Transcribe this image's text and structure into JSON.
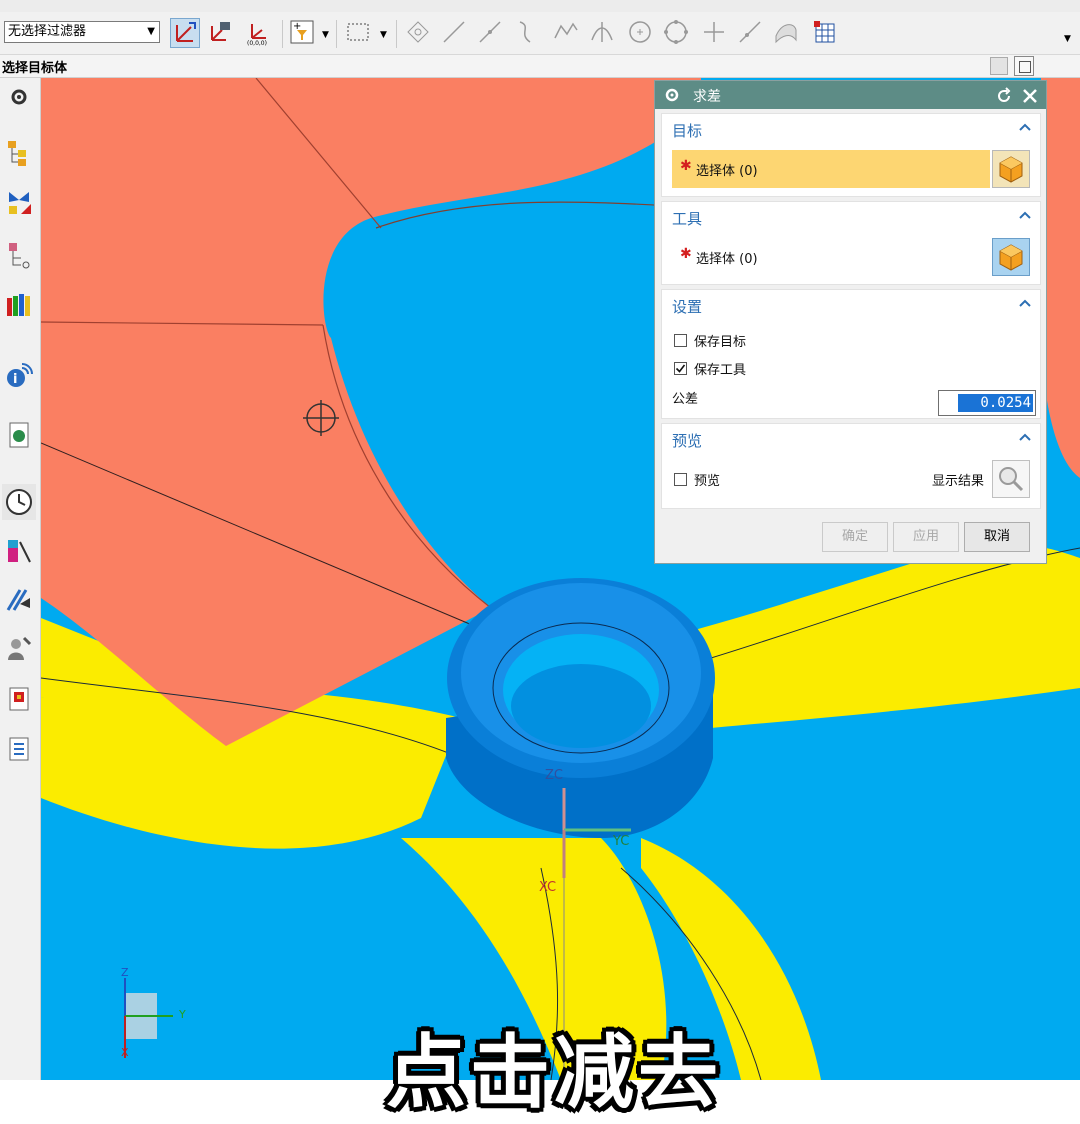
{
  "toolbar": {
    "selection_filter": "无选择过滤器"
  },
  "cue_line": "选择目标体",
  "dialog": {
    "title": "求差",
    "target": {
      "header": "目标",
      "select_label": "选择体 (0)"
    },
    "tool": {
      "header": "工具",
      "select_label": "选择体 (0)"
    },
    "settings": {
      "header": "设置",
      "keep_target": {
        "label": "保存目标",
        "checked": false
      },
      "keep_tool": {
        "label": "保存工具",
        "checked": true
      },
      "tolerance_label": "公差",
      "tolerance_value": "0.0254"
    },
    "preview": {
      "header": "预览",
      "preview_label": "预览",
      "preview_checked": false,
      "show_result_label": "显示结果"
    },
    "buttons": {
      "ok": "确定",
      "apply": "应用",
      "cancel": "取消"
    }
  },
  "viewport": {
    "wcs_labels": {
      "z": "ZC",
      "y": "YC",
      "x": "XC"
    },
    "triad_labels": {
      "z": "Z",
      "y": "Y",
      "x": "X"
    }
  },
  "caption": "点击减去",
  "colors": {
    "blade_blue": "#00aaf0",
    "salmon": "#fa7f62",
    "yellow": "#fbec00",
    "dialog_title": "#5d8c86",
    "highlight_row": "#fdd672",
    "section_header": "#2d6fb3"
  }
}
